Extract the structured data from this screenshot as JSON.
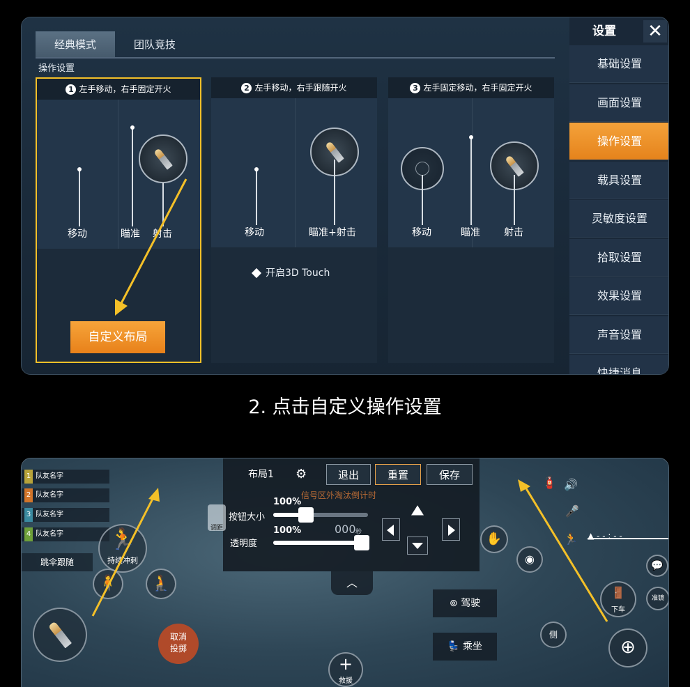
{
  "panel1": {
    "tabs": [
      {
        "label": "经典模式",
        "active": true
      },
      {
        "label": "团队竞技",
        "active": false
      }
    ],
    "section_title": "操作设置",
    "columns": [
      {
        "num": "1",
        "title": "左手移动，右手固定开火",
        "labels": [
          "移动",
          "瞄准",
          "射击"
        ],
        "selected": true
      },
      {
        "num": "2",
        "title": "左手移动，右手跟随开火",
        "labels": [
          "移动",
          "瞄准+射击"
        ],
        "toggle": "开启3D Touch"
      },
      {
        "num": "3",
        "title": "左手固定移动，右手固定开火",
        "labels": [
          "移动",
          "瞄准",
          "射击"
        ]
      }
    ],
    "custom_button": "自定义布局",
    "sidebar": {
      "title": "设置",
      "close": "✕",
      "items": [
        "基础设置",
        "画面设置",
        "操作设置",
        "载具设置",
        "灵敏度设置",
        "拾取设置",
        "效果设置",
        "声音设置",
        "快捷消息"
      ],
      "active_index": 2
    },
    "accent_color": "#f4c028"
  },
  "caption": "2. 点击自定义操作设置",
  "panel2": {
    "teammates": [
      {
        "num": "1",
        "name": "队友名字"
      },
      {
        "num": "2",
        "name": "队友名字"
      },
      {
        "num": "3",
        "name": "队友名字"
      },
      {
        "num": "4",
        "name": "队友名字"
      }
    ],
    "parachute_follow": "跳伞跟随",
    "sprint": "持续冲刺",
    "toolbar": {
      "layout": "布局1",
      "exit": "退出",
      "reset": "重置",
      "save": "保存",
      "countdown": "信号区外淘汰倒计时",
      "button_size_label": "按钮大小",
      "button_size_value": "100%",
      "opacity_label": "透明度",
      "opacity_value": "100%",
      "timer": "000",
      "timer_unit": "秒",
      "adjust": "调距"
    },
    "cancel_throw": [
      "取消",
      "投掷"
    ],
    "drive": "驾驶",
    "ride": "乘坐",
    "rescue": "救援",
    "exit_vehicle": "下车",
    "lean": "侧",
    "scope": "准镜",
    "signal_text": "- - : - -"
  }
}
